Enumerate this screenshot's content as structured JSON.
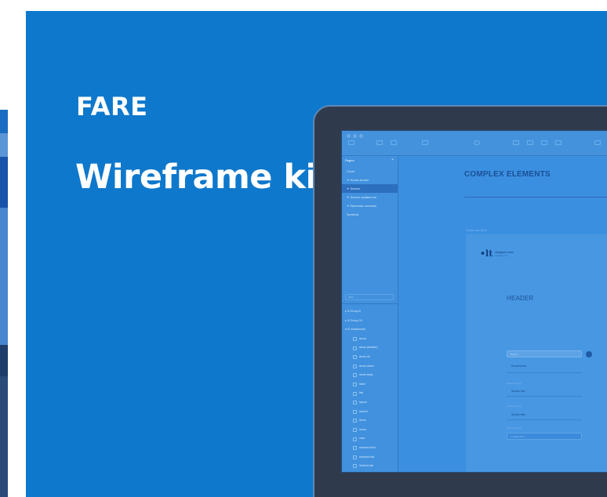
{
  "card": {
    "brand": "FARE",
    "title": "Wireframe kit"
  },
  "app": {
    "sidebar": {
      "header": "Pages",
      "add": "+",
      "pages": [
        {
          "label": "Cover",
          "selected": false
        },
        {
          "label": "✦ Home screen",
          "selected": false
        },
        {
          "label": "✦ Screen",
          "selected": true
        },
        {
          "label": "✦ Screen updated on",
          "selected": false
        },
        {
          "label": "✦ Elements overview",
          "selected": false
        },
        {
          "label": "Symbols",
          "selected": false
        }
      ],
      "filter": "Filter",
      "layers": [
        "▸ ⊟ Group 6",
        "▸ ⊟ Group 24",
        "▾ ⊟ checkboxes",
        "arrow",
        "arrow (header)",
        "arrow d2",
        "arrow down",
        "arrow back",
        "label",
        "tab",
        "layout",
        "search",
        "items",
        "menu",
        "view",
        "selected item",
        "selected tab",
        "Subtext tab"
      ]
    },
    "canvas": {
      "title": "COMPLEX ELEMENTS",
      "artboard_label": "header and fields",
      "logo_mark": "•lt",
      "logo_text": "designers tools",
      "logo_sub": "wireframe kit",
      "header": "HEADER",
      "search_placeholder": "Search",
      "rows": [
        "Recent items",
        "Section item",
        "Section item"
      ],
      "captions": [
        "Header caption",
        "Header caption",
        "Header caption"
      ],
      "selected_field": "Location field"
    }
  }
}
